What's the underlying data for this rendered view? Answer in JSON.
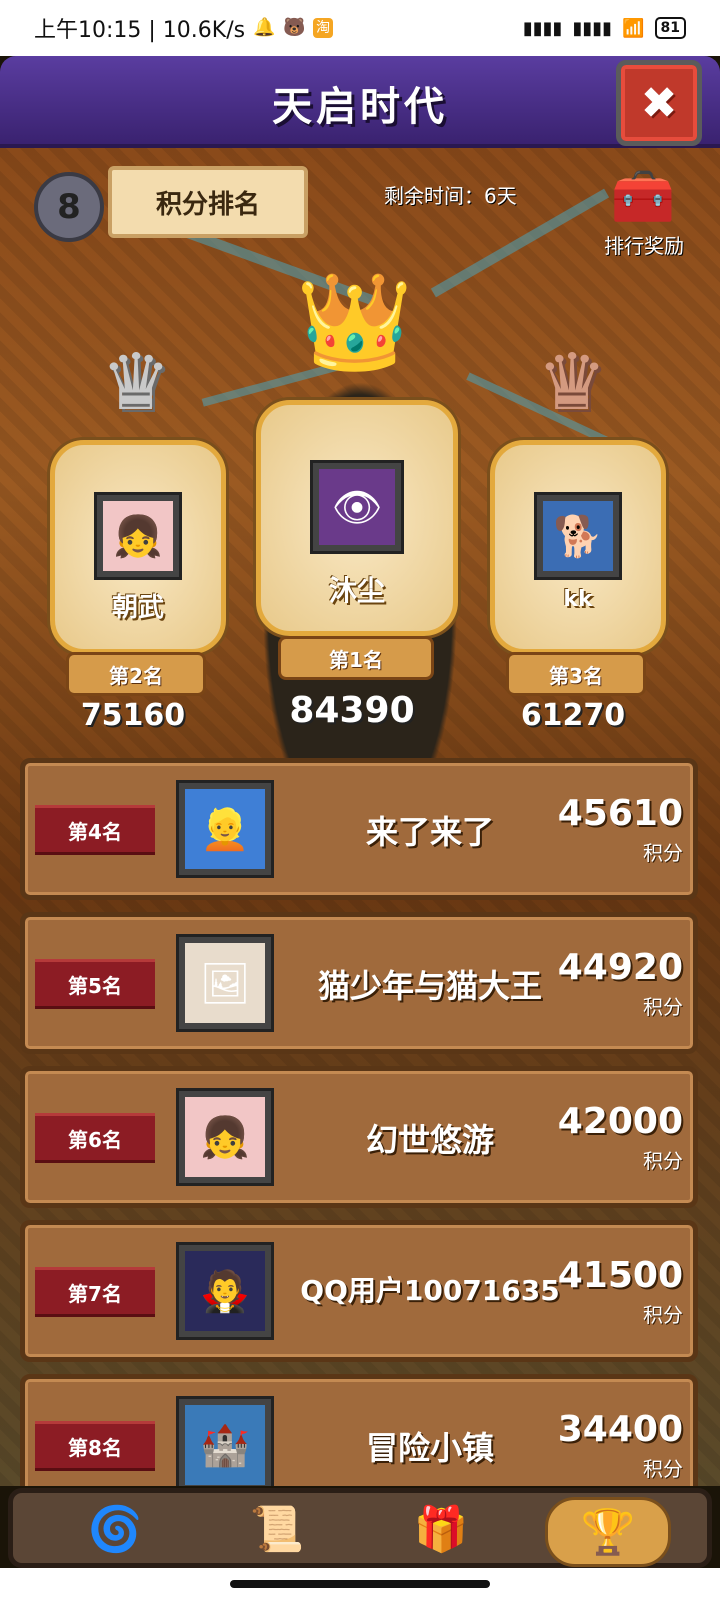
{
  "status_bar": {
    "time_speed": "上午10:15 | 10.6K/s",
    "battery": "81"
  },
  "header": {
    "title": "天启时代",
    "close_symbol": "✖"
  },
  "board": {
    "season_number": "8",
    "tab_label": "积分排名",
    "remaining_time": "剩余时间：6天",
    "reward_label": "排行奖励"
  },
  "podium": {
    "first": {
      "name": "沐尘",
      "rank": "第1名",
      "score": "84390"
    },
    "second": {
      "name": "朝武",
      "rank": "第2名",
      "score": "75160"
    },
    "third": {
      "name": "kk",
      "rank": "第3名",
      "score": "61270"
    }
  },
  "rankings": [
    {
      "rank": "第4名",
      "name": "来了来了",
      "score": "45610",
      "unit": "积分"
    },
    {
      "rank": "第5名",
      "name": "猫少年与猫大王",
      "score": "44920",
      "unit": "积分"
    },
    {
      "rank": "第6名",
      "name": "幻世悠游",
      "score": "42000",
      "unit": "积分"
    },
    {
      "rank": "第7名",
      "name": "QQ用户10071635",
      "score": "41500",
      "unit": "积分"
    },
    {
      "rank": "第8名",
      "name": "冒险小镇",
      "score": "34400",
      "unit": "积分"
    }
  ],
  "icons": {
    "crown_gold": "👑",
    "crown_silver": "♛",
    "crown_bronze": "♛",
    "chest": "🧰",
    "nav_card": "🌀",
    "nav_scroll": "📜",
    "nav_chest": "🎁",
    "nav_ranking": "🏆"
  },
  "colors": {
    "header_purple": "#3a2270",
    "gold": "#e3a93d",
    "rank_tag_red": "#8c1c24",
    "row_brown": "#a06a3c"
  }
}
